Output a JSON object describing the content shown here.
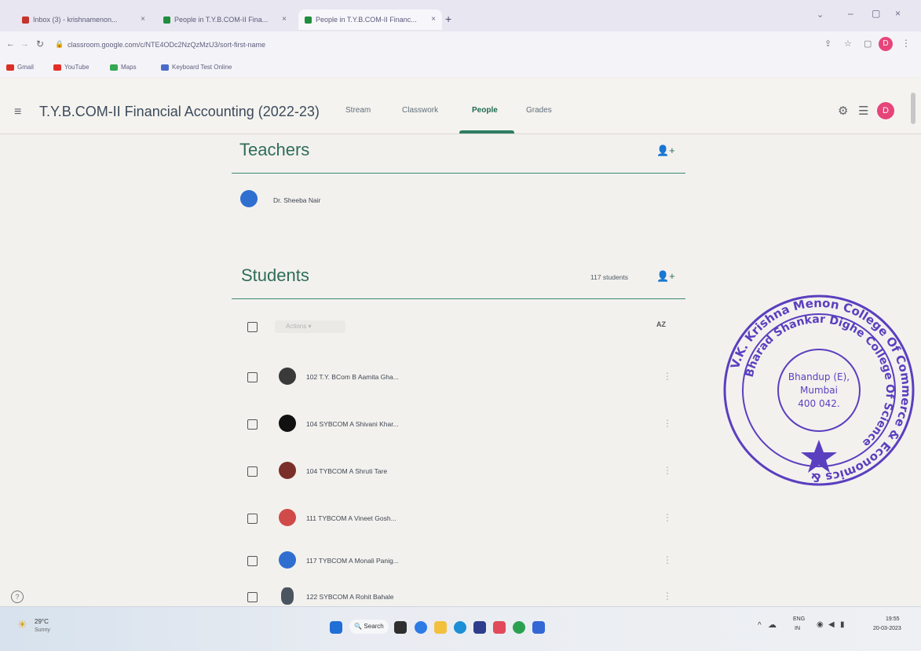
{
  "browser": {
    "tabs": [
      {
        "label": "Inbox (3) - krishnamenon...",
        "color": "#c5342b"
      },
      {
        "label": "People in T.Y.B.COM-II Fina...",
        "color": "#1e8e3e"
      },
      {
        "label": "People in T.Y.B.COM-II Financ...",
        "color": "#1e8e3e"
      }
    ],
    "new_tab_label": "+",
    "window_controls": [
      "–",
      "▢",
      "×"
    ],
    "url": "classroom.google.com/c/NTE4ODc2NzQzMzU3/sort-first-name",
    "bookmarks": [
      {
        "label": "Gmail",
        "color": "#d93025"
      },
      {
        "label": "YouTube",
        "color": "#e52d27"
      },
      {
        "label": "Maps",
        "color": "#34a853"
      },
      {
        "label": "Keyboard Test Online",
        "color": "#4a6cc9"
      }
    ],
    "profile_initial": "D"
  },
  "app": {
    "menu_icon": "hamburger-icon",
    "class_title": "T.Y.B.COM-II Financial Accounting (2022-23)",
    "tabs": [
      "Stream",
      "Classwork",
      "People",
      "Grades"
    ],
    "active_tab": "People",
    "profile_initial": "D"
  },
  "teachers": {
    "heading": "Teachers",
    "items": [
      {
        "name": "Dr. Sheeba Nair",
        "avatar_color": "#2f6fd0"
      }
    ]
  },
  "students": {
    "heading": "Students",
    "count_label": "117 students",
    "actions_label": "Actions",
    "sort_label": "AZ",
    "items": [
      {
        "name": "102 T.Y. BCom B Aamita Gha...",
        "avatar_color": "#3a3a3a"
      },
      {
        "name": "104 SYBCOM A Shivani Khar...",
        "avatar_color": "#111111"
      },
      {
        "name": "104 TYBCOM A Shruti Tare",
        "avatar_color": "#7a2f2a"
      },
      {
        "name": "111 TYBCOM A Vineet Gosh...",
        "avatar_color": "#d04a4a"
      },
      {
        "name": "117 TYBCOM A Monali Panig...",
        "avatar_color": "#2f6fd0"
      },
      {
        "name": "122 SYBCOM A Rohit Bahale",
        "avatar_color": "#4a5560"
      }
    ]
  },
  "stamp": {
    "outer_text": "V.K. Krishna Menon College Of Commerce & Economics & Shri",
    "inner_text": "Bharad Shankar Dighe College Of Science",
    "center": [
      "Bhandup (E),",
      "Mumbai",
      "400 042."
    ],
    "color": "#5a3fbf"
  },
  "taskbar": {
    "weather_temp": "29°C",
    "weather_desc": "Sunny",
    "search_label": "Search",
    "language": "ENG",
    "region": "IN",
    "time": "19:55",
    "date": "20-03-2023"
  }
}
